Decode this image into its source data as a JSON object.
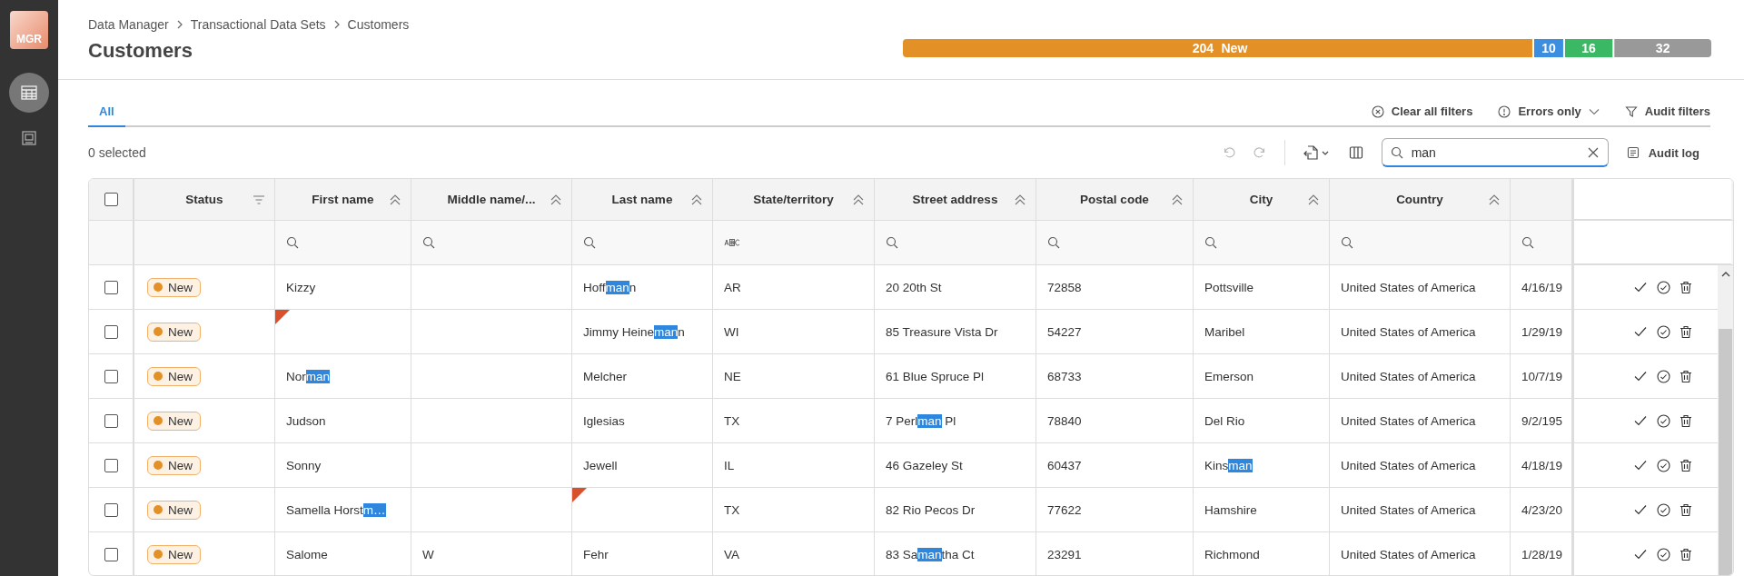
{
  "sidebar": {
    "logo": "MGR",
    "items": [
      {
        "selected": true
      },
      {
        "selected": false
      }
    ]
  },
  "breadcrumb": [
    "Data Manager",
    "Transactional Data Sets",
    "Customers"
  ],
  "title": "Customers",
  "status_summary": {
    "chart_data": {
      "type": "bar",
      "orientation": "horizontal",
      "stacked": true,
      "data_labels": true,
      "series": [
        {
          "name": "New",
          "color": "#e39027",
          "values": [
            204
          ]
        },
        {
          "color": "#3b8ee0",
          "values": [
            10
          ]
        },
        {
          "color": "#3bb863",
          "values": [
            16
          ]
        },
        {
          "color": "#999999",
          "values": [
            32
          ]
        }
      ]
    }
  },
  "all_selected": false,
  "tabs": [
    {
      "label": "All",
      "selected": true
    }
  ],
  "filter_actions": [
    {
      "kind": "clear",
      "label": "Clear all filters"
    },
    {
      "kind": "errors",
      "label": "Errors only"
    },
    {
      "kind": "audit",
      "label": "Audit filters"
    }
  ],
  "selected_count": "0 selected",
  "toolbar": {
    "undo_disabled": true,
    "redo_disabled": true
  },
  "search": {
    "value": "man"
  },
  "audit_log": "Audit log",
  "columns": [
    {
      "name": "Status",
      "kind": "status"
    },
    {
      "name": "First name",
      "kind": "search"
    },
    {
      "name": "Middle name/...",
      "kind": "search"
    },
    {
      "name": "Last name",
      "kind": "search"
    },
    {
      "name": "State/territory",
      "kind": "text"
    },
    {
      "name": "Street address",
      "kind": "search"
    },
    {
      "name": "Postal code",
      "kind": "search"
    },
    {
      "name": "City",
      "kind": "search"
    },
    {
      "name": "Country",
      "kind": "search"
    },
    {
      "kind": "unnamed"
    }
  ],
  "rows": [
    {
      "selected": false,
      "status": "New",
      "cells": [
        {
          "text": "Kizzy"
        },
        null,
        {
          "text": "Hoff**man**n"
        },
        {
          "text": "AR"
        },
        {
          "text": "20 20th St"
        },
        {
          "text": "72858"
        },
        {
          "text": "Pottsville"
        },
        {
          "text": "United States of America"
        },
        {
          "text": "4/16/19"
        }
      ]
    },
    {
      "selected": false,
      "status": "New",
      "cells": [
        {
          "error": true
        },
        null,
        {
          "text": "Jimmy Heine**man**n"
        },
        {
          "text": "WI"
        },
        {
          "text": "85 Treasure Vista Dr"
        },
        {
          "text": "54227"
        },
        {
          "text": "Maribel"
        },
        {
          "text": "United States of America"
        },
        {
          "text": "1/29/19"
        }
      ]
    },
    {
      "selected": false,
      "status": "New",
      "cells": [
        {
          "text": "Nor**man**"
        },
        null,
        {
          "text": "Melcher"
        },
        {
          "text": "NE"
        },
        {
          "text": "61 Blue Spruce Pl"
        },
        {
          "text": "68733"
        },
        {
          "text": "Emerson"
        },
        {
          "text": "United States of America"
        },
        {
          "text": "10/7/19"
        }
      ]
    },
    {
      "selected": false,
      "status": "New",
      "cells": [
        {
          "text": "Judson"
        },
        null,
        {
          "text": "Iglesias"
        },
        {
          "text": "TX"
        },
        {
          "text": "7 Perl**man** Pl"
        },
        {
          "text": "78840"
        },
        {
          "text": "Del Rio"
        },
        {
          "text": "United States of America"
        },
        {
          "text": "9/2/195"
        }
      ]
    },
    {
      "selected": false,
      "status": "New",
      "cells": [
        {
          "text": "Sonny"
        },
        null,
        {
          "text": "Jewell"
        },
        {
          "text": "IL"
        },
        {
          "text": "46 Gazeley St"
        },
        {
          "text": "60437"
        },
        {
          "text": "Kins**man**"
        },
        {
          "text": "United States of America"
        },
        {
          "text": "4/18/19"
        }
      ]
    },
    {
      "selected": false,
      "status": "New",
      "cells": [
        {
          "text": "Samella Horst**m…**"
        },
        null,
        {
          "error": true
        },
        {
          "text": "TX"
        },
        {
          "text": "82 Rio Pecos Dr"
        },
        {
          "text": "77622"
        },
        {
          "text": "Hamshire"
        },
        {
          "text": "United States of America"
        },
        {
          "text": "4/23/20"
        }
      ]
    },
    {
      "selected": false,
      "status": "New",
      "cells": [
        {
          "text": "Salome"
        },
        {
          "text": "W"
        },
        {
          "text": "Fehr"
        },
        {
          "text": "VA"
        },
        {
          "text": "83 Sa**man**tha Ct"
        },
        {
          "text": "23291"
        },
        {
          "text": "Richmond"
        },
        {
          "text": "United States of America"
        },
        {
          "text": "1/28/19"
        }
      ]
    }
  ]
}
